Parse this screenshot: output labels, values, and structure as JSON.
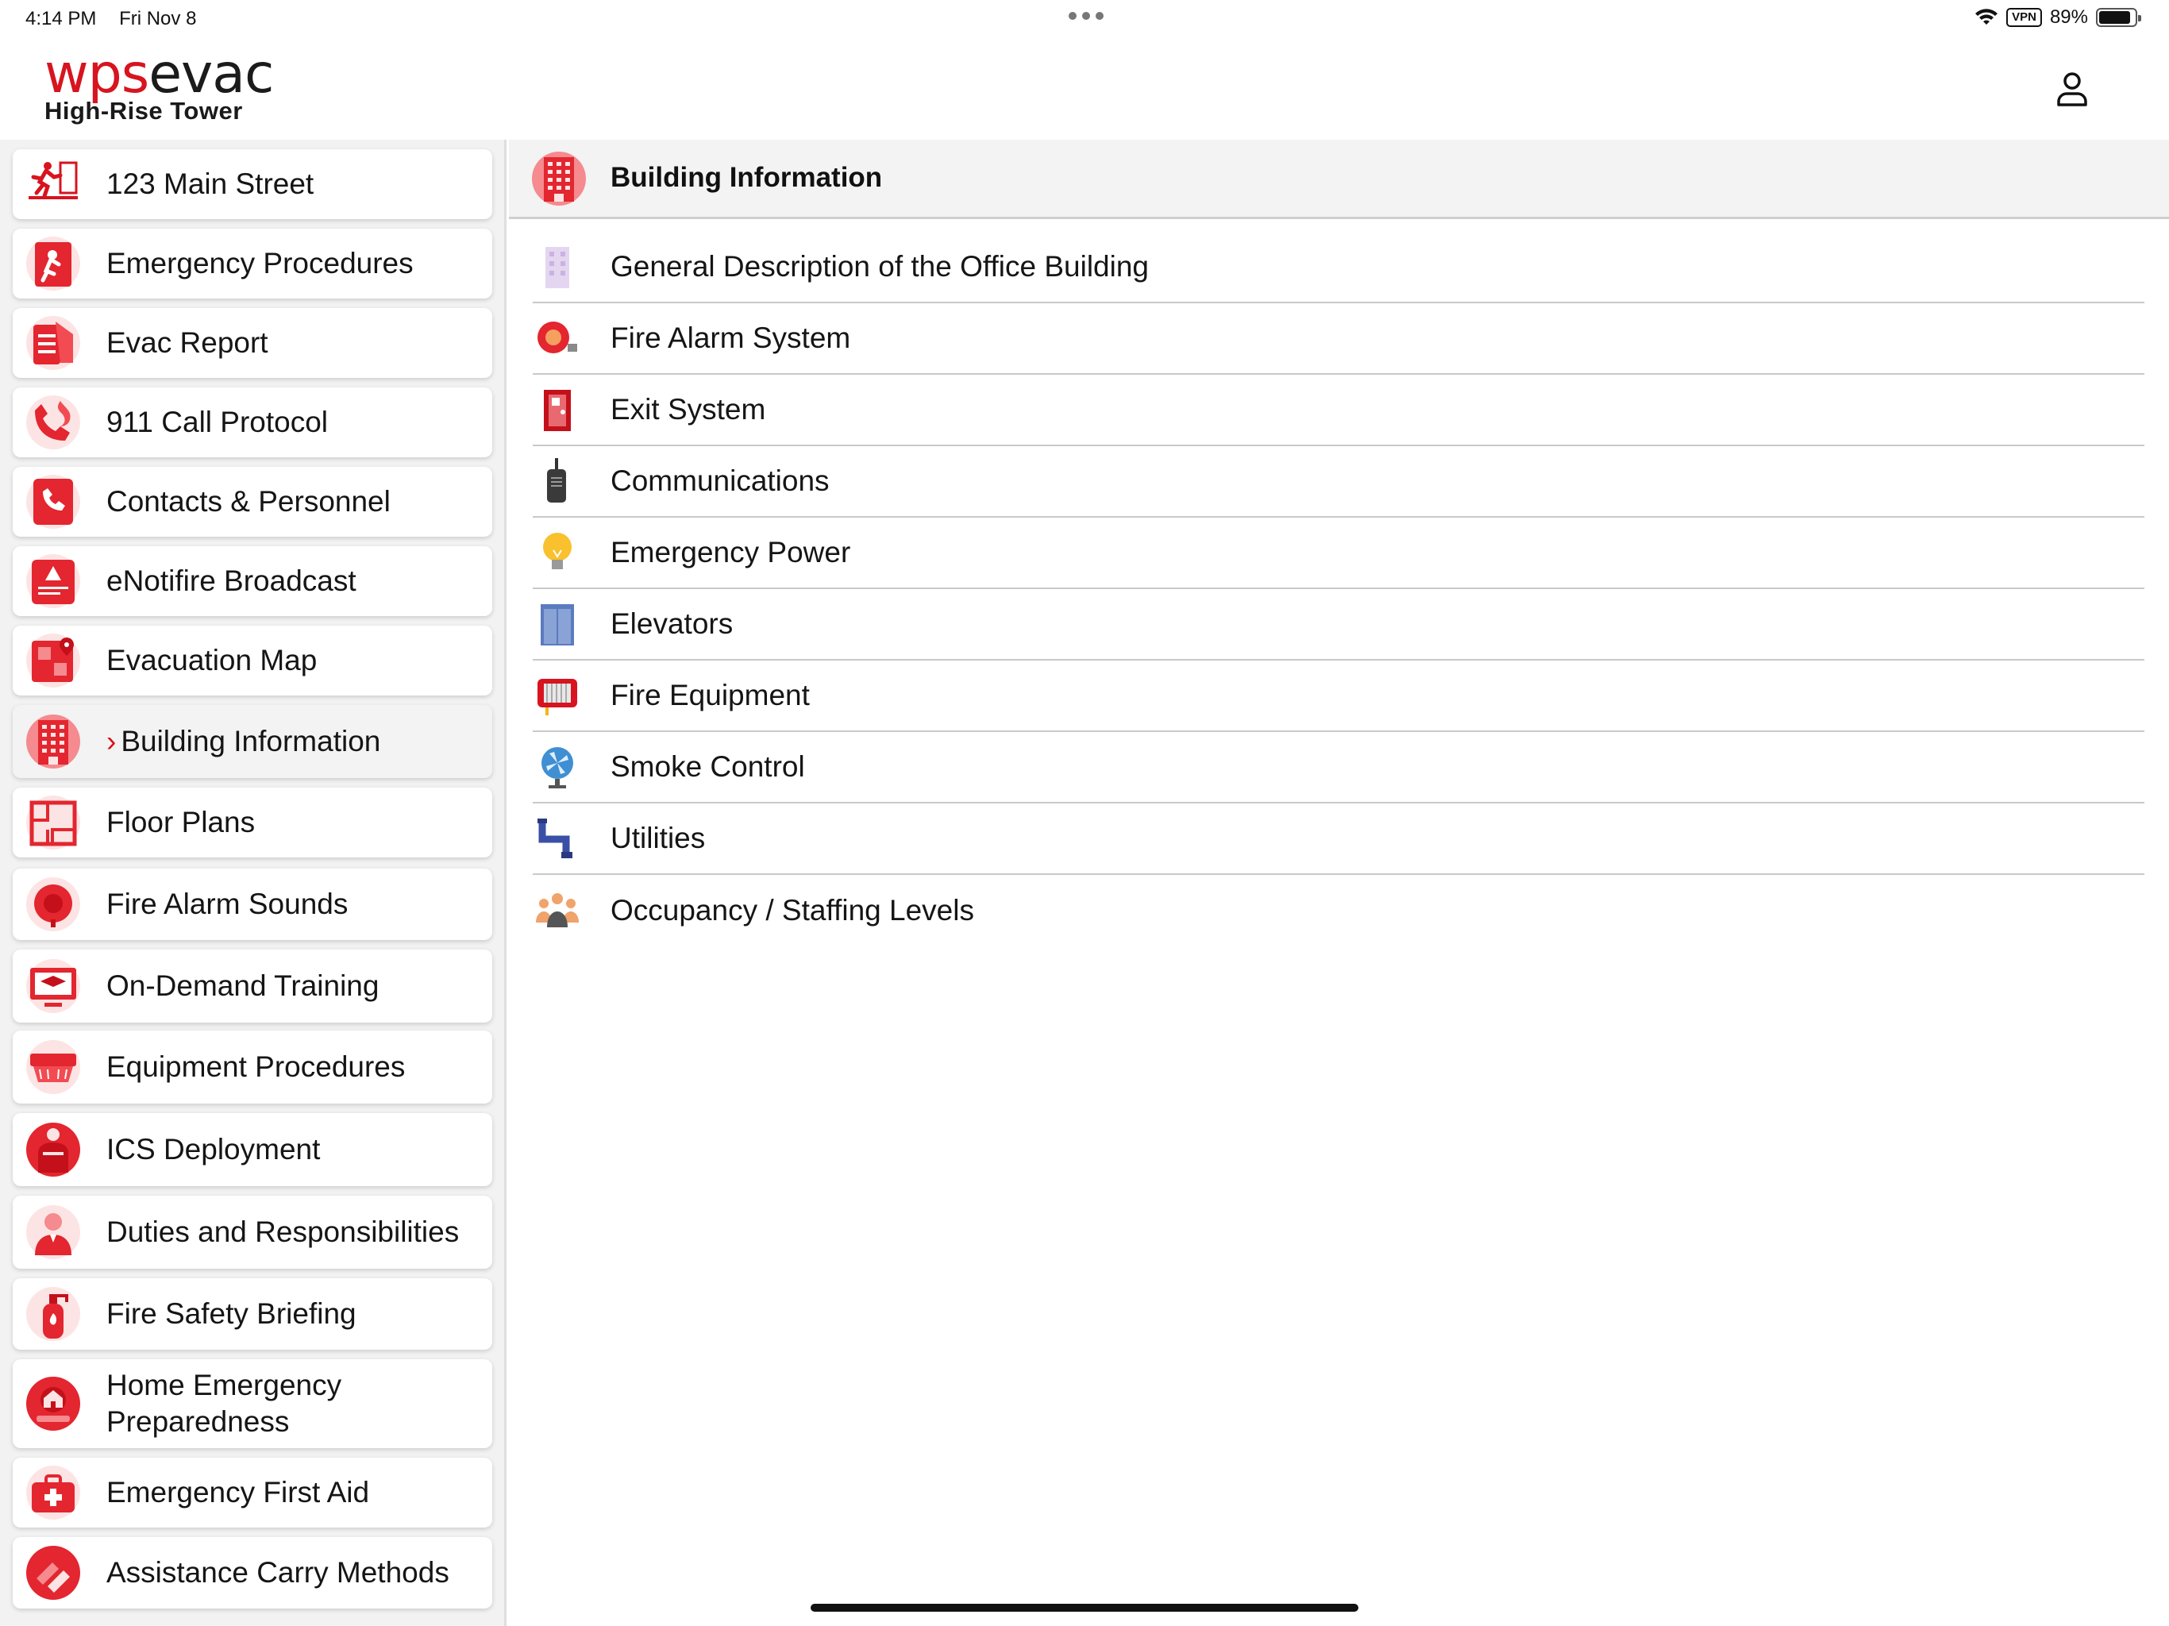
{
  "status_bar": {
    "time": "4:14 PM",
    "date": "Fri Nov 8",
    "vpn": "VPN",
    "battery": "89%",
    "battery_level": 0.89
  },
  "header": {
    "logo_wps": "wps",
    "logo_evac": "evac",
    "subtitle": "High-Rise Tower",
    "user_icon": "person-icon"
  },
  "sidebar": {
    "items": [
      {
        "label": "123 Main Street",
        "icon": "exit-running-icon"
      },
      {
        "label": "Emergency Procedures",
        "icon": "emergency-procedures-icon"
      },
      {
        "label": "Evac Report",
        "icon": "evac-report-icon"
      },
      {
        "label": "911 Call Protocol",
        "icon": "phone-call-icon"
      },
      {
        "label": "Contacts & Personnel",
        "icon": "contacts-phone-icon"
      },
      {
        "label": "eNotifire Broadcast",
        "icon": "broadcast-alert-icon"
      },
      {
        "label": "Evacuation Map",
        "icon": "evacuation-map-icon"
      },
      {
        "label": "Building Information",
        "icon": "building-icon",
        "active": true,
        "chevron": "›"
      },
      {
        "label": "Floor Plans",
        "icon": "floor-plan-icon"
      },
      {
        "label": "Fire Alarm Sounds",
        "icon": "alarm-bell-icon"
      },
      {
        "label": "On-Demand Training",
        "icon": "training-icon"
      },
      {
        "label": "Equipment Procedures",
        "icon": "equipment-icon"
      },
      {
        "label": "ICS Deployment",
        "icon": "ics-vest-icon"
      },
      {
        "label": "Duties and Responsibilities",
        "icon": "person-duties-icon"
      },
      {
        "label": "Fire Safety Briefing",
        "icon": "extinguisher-icon"
      },
      {
        "label": "Home Emergency Preparedness",
        "icon": "home-emergency-icon"
      },
      {
        "label": "Emergency First Aid",
        "icon": "first-aid-icon"
      },
      {
        "label": "Assistance Carry Methods",
        "icon": "carry-hands-icon"
      }
    ]
  },
  "main": {
    "title": "Building Information",
    "title_icon": "building-icon",
    "rows": [
      {
        "label": "General Description of the Office Building",
        "icon": "office-building-icon"
      },
      {
        "label": "Fire Alarm System",
        "icon": "fire-alarm-icon"
      },
      {
        "label": "Exit System",
        "icon": "exit-door-icon"
      },
      {
        "label": "Communications",
        "icon": "radio-icon"
      },
      {
        "label": "Emergency Power",
        "icon": "lightbulb-icon"
      },
      {
        "label": "Elevators",
        "icon": "elevator-icon"
      },
      {
        "label": "Fire Equipment",
        "icon": "fire-hose-icon"
      },
      {
        "label": "Smoke Control",
        "icon": "fan-icon"
      },
      {
        "label": "Utilities",
        "icon": "pipe-icon"
      },
      {
        "label": "Occupancy / Staffing Levels",
        "icon": "people-group-icon"
      }
    ]
  },
  "colors": {
    "brand_red": "#d7141f",
    "sidebar_bg": "#f2f2f2",
    "header_bg": "#f3f3f3"
  }
}
